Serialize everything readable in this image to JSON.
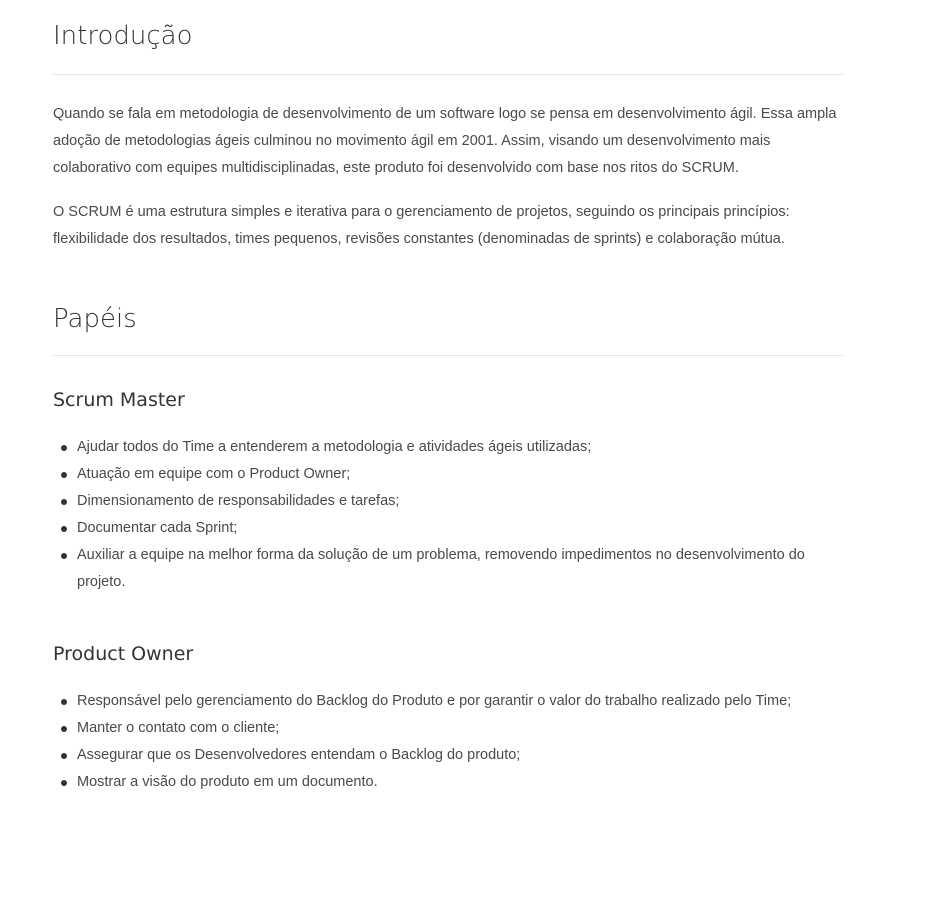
{
  "intro": {
    "title": "Introdução",
    "paragraphs": [
      "Quando se fala em metodologia de desenvolvimento de um software logo se pensa em desenvolvimento ágil. Essa ampla adoção de metodologias ágeis culminou no movimento ágil em 2001. Assim, visando um desenvolvimento mais colaborativo com equipes multidisciplinadas, este produto foi desenvolvido com base nos ritos do SCRUM.",
      "O SCRUM é uma estrutura simples e iterativa para o gerenciamento de projetos, seguindo os principais princípios: flexibilidade dos resultados, times pequenos, revisões constantes (denominadas de sprints) e colaboração mútua."
    ]
  },
  "papeis": {
    "title": "Papéis",
    "scrum_master": {
      "title": "Scrum Master",
      "items": [
        "Ajudar todos do Time a entenderem a metodologia e atividades ágeis utilizadas;",
        "Atuação em equipe com o Product Owner;",
        "Dimensionamento de responsabilidades e tarefas;",
        "Documentar cada Sprint;",
        "Auxiliar a equipe na melhor forma da solução de um problema, removendo impedimentos no desenvolvimento do projeto."
      ]
    },
    "product_owner": {
      "title": "Product Owner",
      "items": [
        "Responsável pelo gerenciamento do Backlog do Produto e por garantir o valor do trabalho realizado pelo Time;",
        "Manter o contato com o cliente;",
        "Assegurar que os Desenvolvedores entendam o Backlog do produto;",
        "Mostrar a visão do produto em um documento."
      ]
    }
  }
}
